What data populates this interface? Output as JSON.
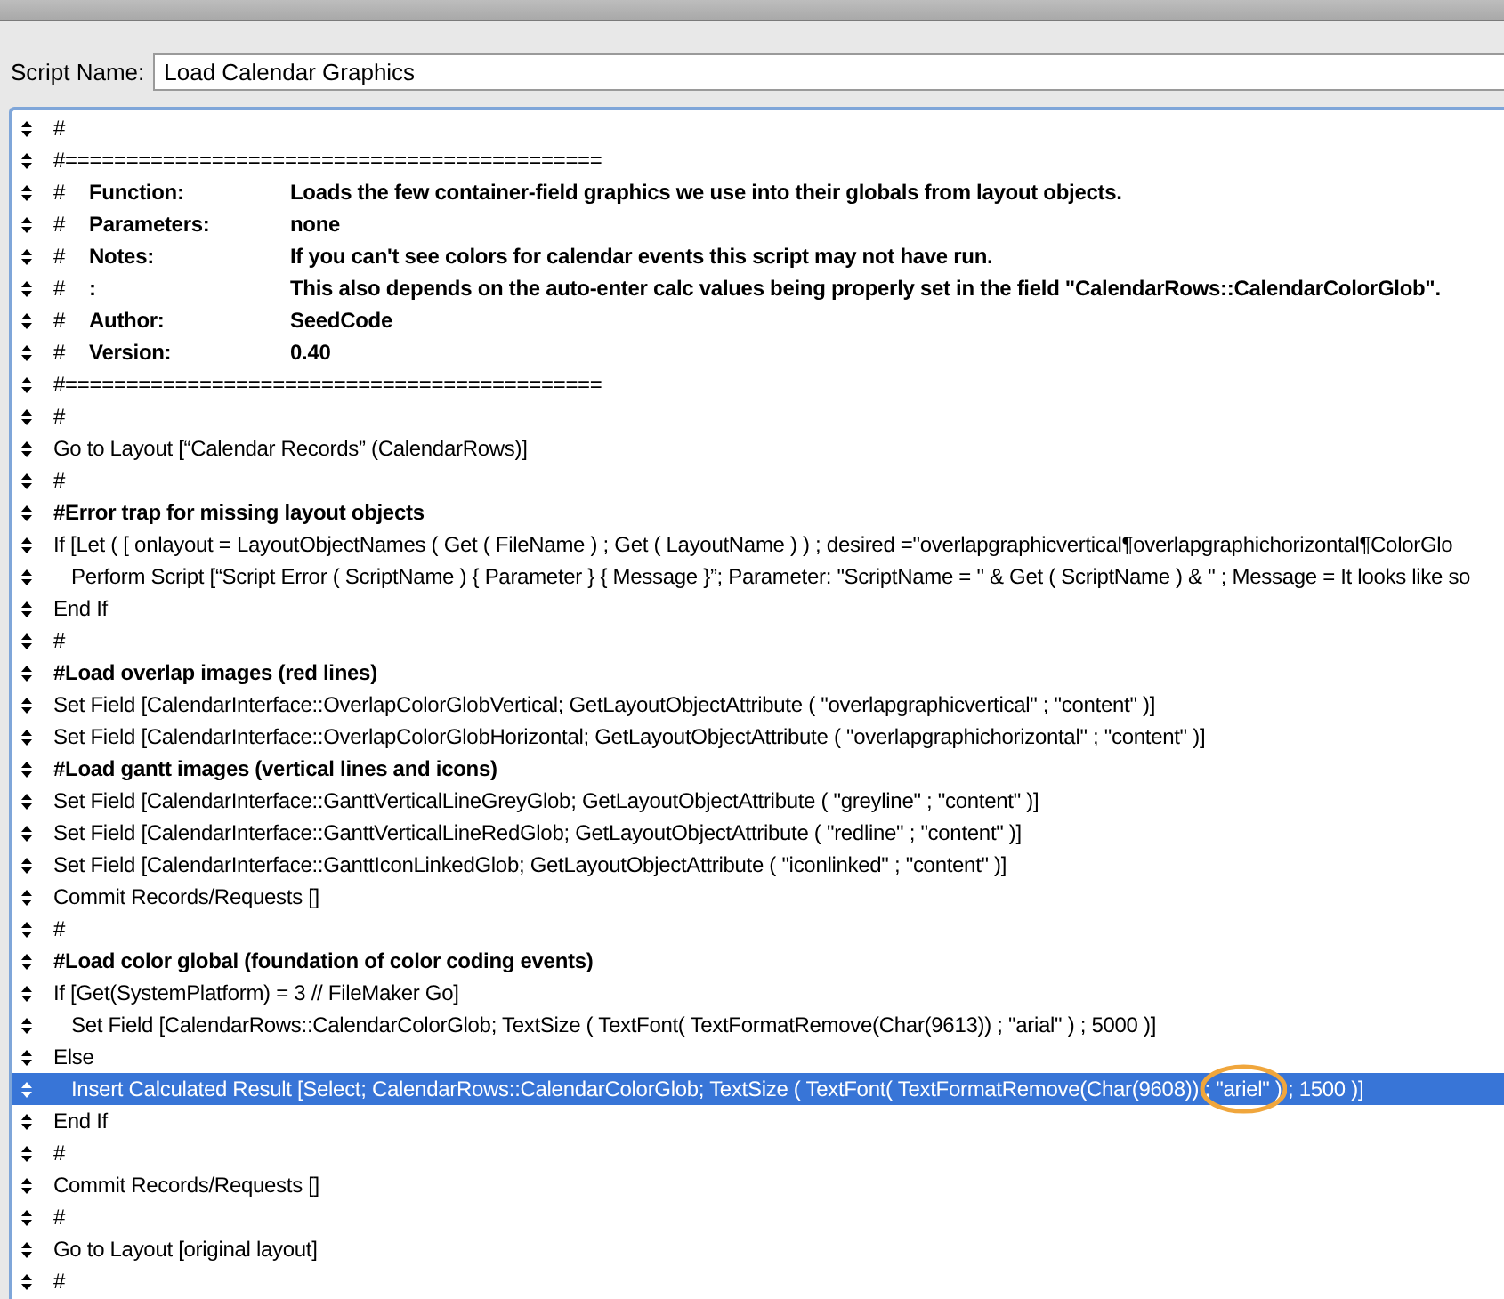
{
  "script_name": {
    "label": "Script Name:",
    "value": "Load Calendar Graphics"
  },
  "steps": [
    {
      "kind": "comment",
      "text": "#",
      "bold": false,
      "selected": false
    },
    {
      "kind": "comment",
      "text": "#============================================",
      "bold": false,
      "selected": false
    },
    {
      "kind": "field",
      "text": "#",
      "label": "Function:",
      "value": "Loads the few container-field graphics we use into their globals from layout objects.",
      "selected": false
    },
    {
      "kind": "field",
      "text": "#",
      "label": "Parameters:",
      "value": "none",
      "selected": false
    },
    {
      "kind": "field",
      "text": "#",
      "label": "Notes:",
      "value": "If you can't see colors for calendar events this script may not have run.",
      "selected": false
    },
    {
      "kind": "field",
      "text": "#",
      "label": ":",
      "value": "This also depends on the auto-enter calc values being properly set in the field \"CalendarRows::CalendarColorGlob\".",
      "selected": false
    },
    {
      "kind": "field",
      "text": "#",
      "label": "Author:",
      "value": "SeedCode",
      "selected": false
    },
    {
      "kind": "field",
      "text": "#",
      "label": "Version:",
      "value": "0.40",
      "selected": false
    },
    {
      "kind": "comment",
      "text": "#============================================",
      "bold": false,
      "selected": false
    },
    {
      "kind": "comment",
      "text": "#",
      "bold": false,
      "selected": false
    },
    {
      "kind": "step",
      "text": "Go to Layout [“Calendar Records” (CalendarRows)]",
      "selected": false
    },
    {
      "kind": "comment",
      "text": "#",
      "bold": false,
      "selected": false
    },
    {
      "kind": "comment",
      "text": "#Error trap for missing layout objects",
      "bold": true,
      "selected": false
    },
    {
      "kind": "step",
      "text": "If [Let ( [ onlayout = LayoutObjectNames ( Get ( FileName ) ; Get ( LayoutName ) ) ; desired =\"overlapgraphicvertical¶overlapgraphichorizontal¶ColorGlo",
      "selected": false,
      "children": [
        {
          "kind": "step",
          "text": "Perform Script [“Script Error ( ScriptName ) { Parameter } { Message }”; Parameter: \"ScriptName = \" & Get ( ScriptName ) &   \" ; Message = It looks like so",
          "selected": false
        }
      ]
    },
    {
      "kind": "step",
      "text": "End If",
      "selected": false
    },
    {
      "kind": "comment",
      "text": "#",
      "bold": false,
      "selected": false
    },
    {
      "kind": "comment",
      "text": "#Load overlap images (red lines)",
      "bold": true,
      "selected": false
    },
    {
      "kind": "step",
      "text": "Set Field [CalendarInterface::OverlapColorGlobVertical; GetLayoutObjectAttribute ( \"overlapgraphicvertical\" ; \"content\" )]",
      "selected": false
    },
    {
      "kind": "step",
      "text": "Set Field [CalendarInterface::OverlapColorGlobHorizontal; GetLayoutObjectAttribute ( \"overlapgraphichorizontal\" ; \"content\" )]",
      "selected": false
    },
    {
      "kind": "comment",
      "text": "#Load gantt images (vertical lines and icons)",
      "bold": true,
      "selected": false
    },
    {
      "kind": "step",
      "text": "Set Field [CalendarInterface::GanttVerticalLineGreyGlob; GetLayoutObjectAttribute ( \"greyline\" ; \"content\" )]",
      "selected": false
    },
    {
      "kind": "step",
      "text": "Set Field [CalendarInterface::GanttVerticalLineRedGlob; GetLayoutObjectAttribute ( \"redline\" ; \"content\" )]",
      "selected": false
    },
    {
      "kind": "step",
      "text": "Set Field [CalendarInterface::GanttIconLinkedGlob; GetLayoutObjectAttribute ( \"iconlinked\" ; \"content\" )]",
      "selected": false
    },
    {
      "kind": "step",
      "text": "Commit Records/Requests []",
      "selected": false
    },
    {
      "kind": "comment",
      "text": "#",
      "bold": false,
      "selected": false
    },
    {
      "kind": "comment",
      "text": "#Load color global (foundation of color coding events)",
      "bold": true,
      "selected": false
    },
    {
      "kind": "step",
      "text": "If [Get(SystemPlatform) = 3 // FileMaker Go]",
      "selected": false,
      "children": [
        {
          "kind": "step",
          "text": "Set Field [CalendarRows::CalendarColorGlob; TextSize ( TextFont( TextFormatRemove(Char(9613)) ; \"arial\" ) ; 5000 )]",
          "selected": false
        }
      ]
    },
    {
      "kind": "step",
      "text": "Else",
      "selected": false,
      "children": [
        {
          "kind": "step",
          "text": "Insert Calculated Result [Select; CalendarRows::CalendarColorGlob; TextSize ( TextFont( TextFormatRemove(Char(9608)) ; \"ariel\" ) ; 1500 )]",
          "selected": true,
          "circled": true
        }
      ]
    },
    {
      "kind": "step",
      "text": "End If",
      "selected": false
    },
    {
      "kind": "comment",
      "text": "#",
      "bold": false,
      "selected": false
    },
    {
      "kind": "step",
      "text": "Commit Records/Requests []",
      "selected": false
    },
    {
      "kind": "comment",
      "text": "#",
      "bold": false,
      "selected": false
    },
    {
      "kind": "step",
      "text": "Go to Layout [original layout]",
      "selected": false
    },
    {
      "kind": "comment",
      "text": "#",
      "bold": false,
      "selected": false
    }
  ]
}
